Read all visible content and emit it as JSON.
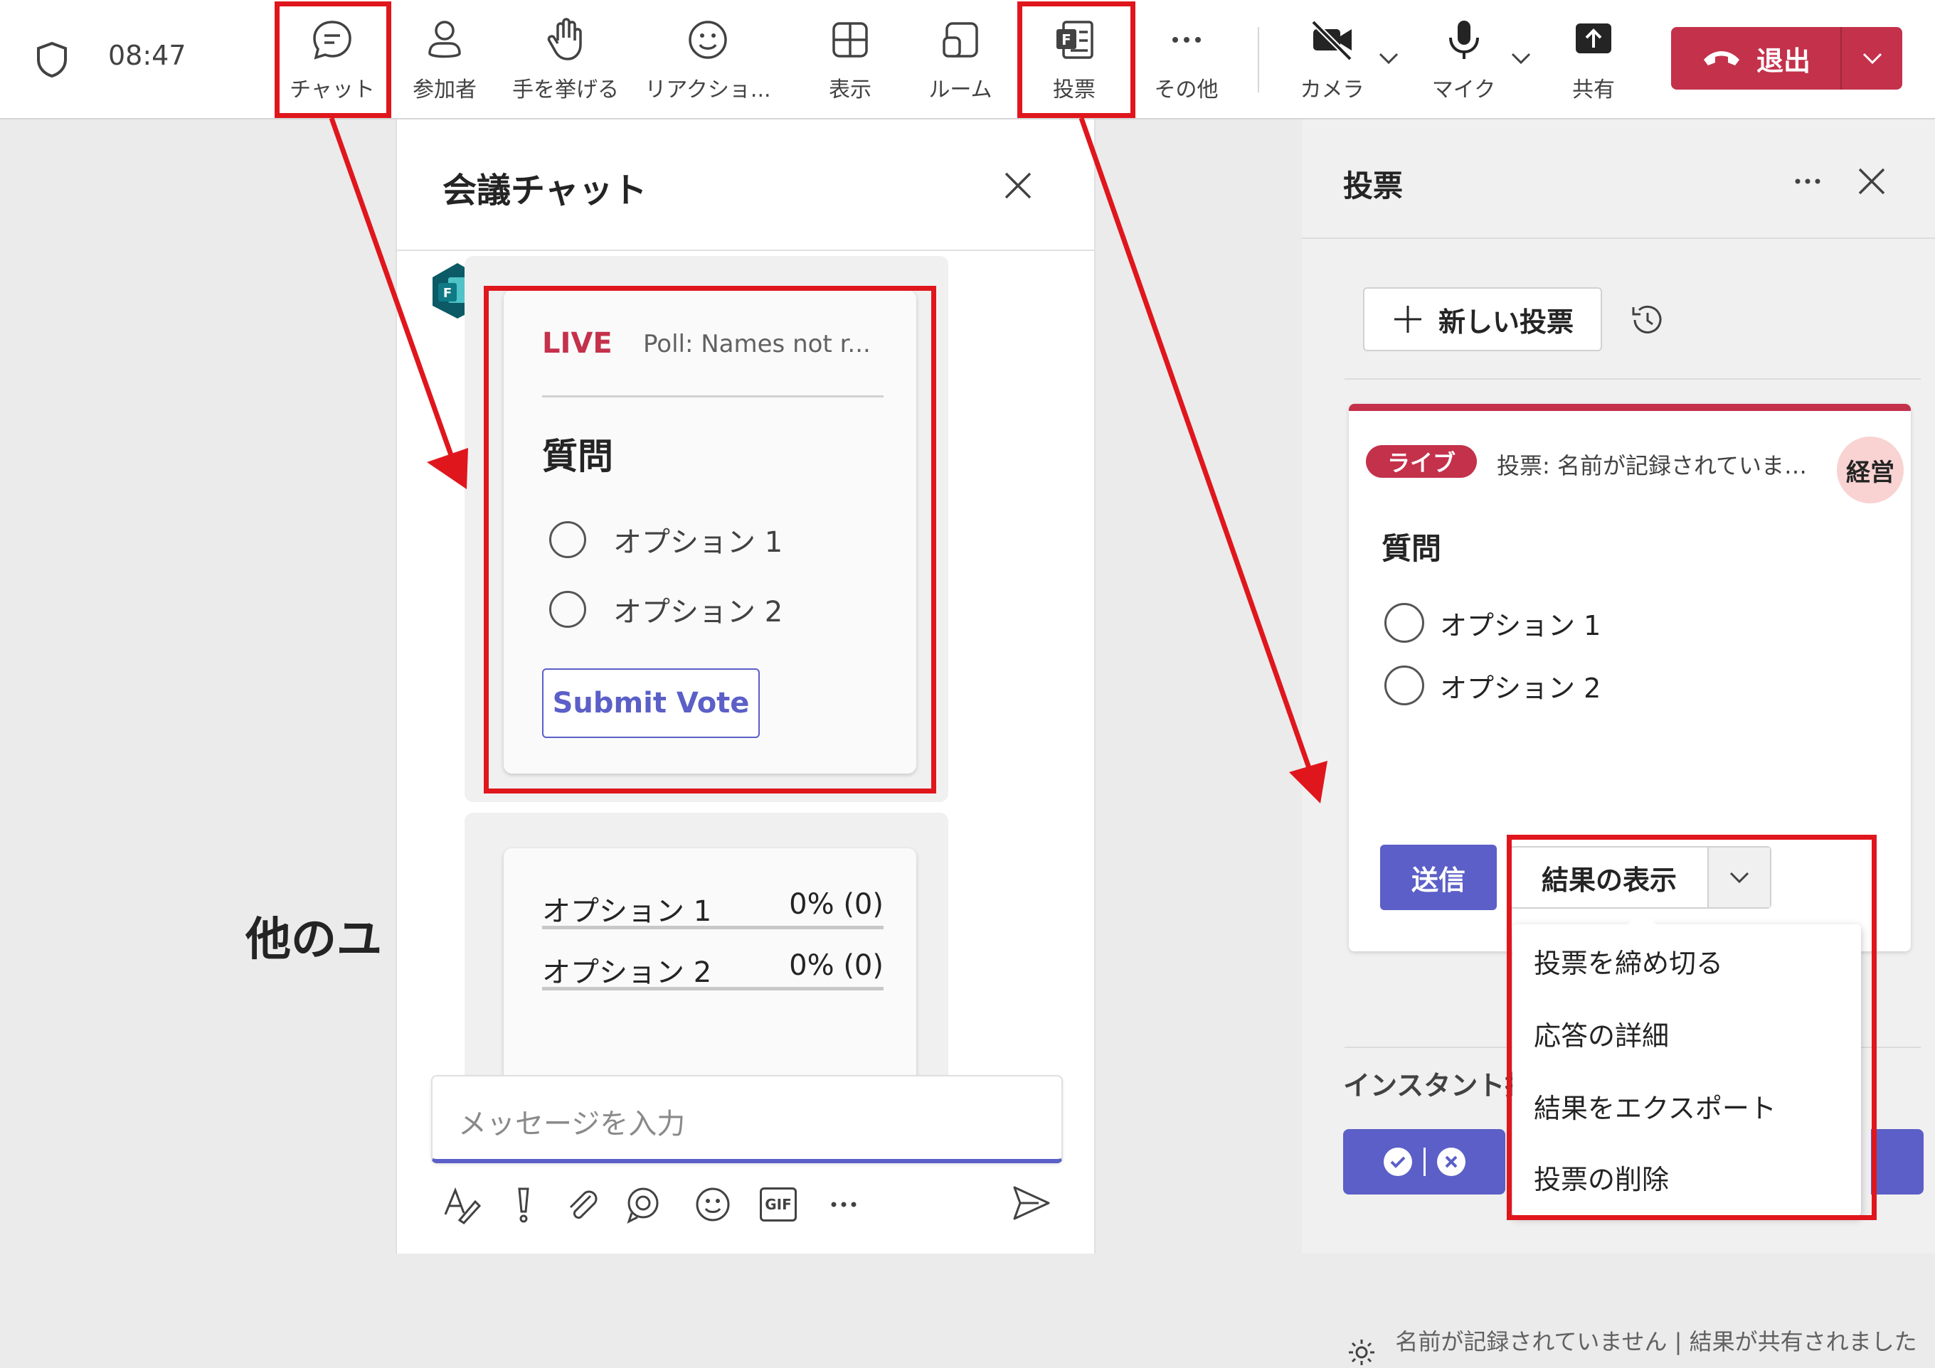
{
  "topbar": {
    "time": "08:47",
    "items": [
      {
        "label": "チャット",
        "icon": "chat-icon"
      },
      {
        "label": "参加者",
        "icon": "people-icon"
      },
      {
        "label": "手を挙げる",
        "icon": "raise-hand-icon"
      },
      {
        "label": "リアクショ...",
        "icon": "reaction-icon"
      },
      {
        "label": "表示",
        "icon": "view-icon"
      },
      {
        "label": "ルーム",
        "icon": "rooms-icon"
      },
      {
        "label": "投票",
        "icon": "forms-poll-icon"
      },
      {
        "label": "その他",
        "icon": "more-icon"
      },
      {
        "label": "カメラ",
        "icon": "camera-off-icon"
      },
      {
        "label": "マイク",
        "icon": "mic-icon"
      },
      {
        "label": "共有",
        "icon": "share-icon"
      }
    ],
    "leave_label": "退出"
  },
  "stage": {
    "partial_text": "他のユ"
  },
  "chat": {
    "title": "会議チャット",
    "poll_card": {
      "live_label": "LIVE",
      "poll_title": "Poll: Names not r...",
      "question": "質問",
      "options": [
        "オプション 1",
        "オプション 2"
      ],
      "submit_label": "Submit Vote"
    },
    "results_card": {
      "rows": [
        {
          "label": "オプション 1",
          "value": "0% (0)"
        },
        {
          "label": "オプション 2",
          "value": "0% (0)"
        }
      ]
    },
    "input_placeholder": "メッセージを入力",
    "tools": [
      "format-icon",
      "important-icon",
      "attach-icon",
      "loop-icon",
      "emoji-icon",
      "gif-icon",
      "more-icon",
      "send-icon"
    ],
    "gif_label": "GIF"
  },
  "poll_panel": {
    "title": "投票",
    "new_poll_label": "新しい投票",
    "card": {
      "live_badge": "ライブ",
      "title": "投票: 名前が記録されていま…",
      "avatar_text": "経営",
      "question": "質問",
      "options": [
        "オプション 1",
        "オプション 2"
      ],
      "send_label": "送信",
      "results_label": "結果の表示"
    },
    "menu": [
      "投票を締め切る",
      "応答の詳細",
      "結果をエクスポート",
      "投票の削除"
    ],
    "instant_label": "インスタント投",
    "footer_text": "名前が記録されていません | 結果が共有されました"
  },
  "colors": {
    "accent": "#5b5fc7",
    "leave": "#c4314b",
    "highlight": "#e0161d",
    "live": "#c4314b"
  }
}
